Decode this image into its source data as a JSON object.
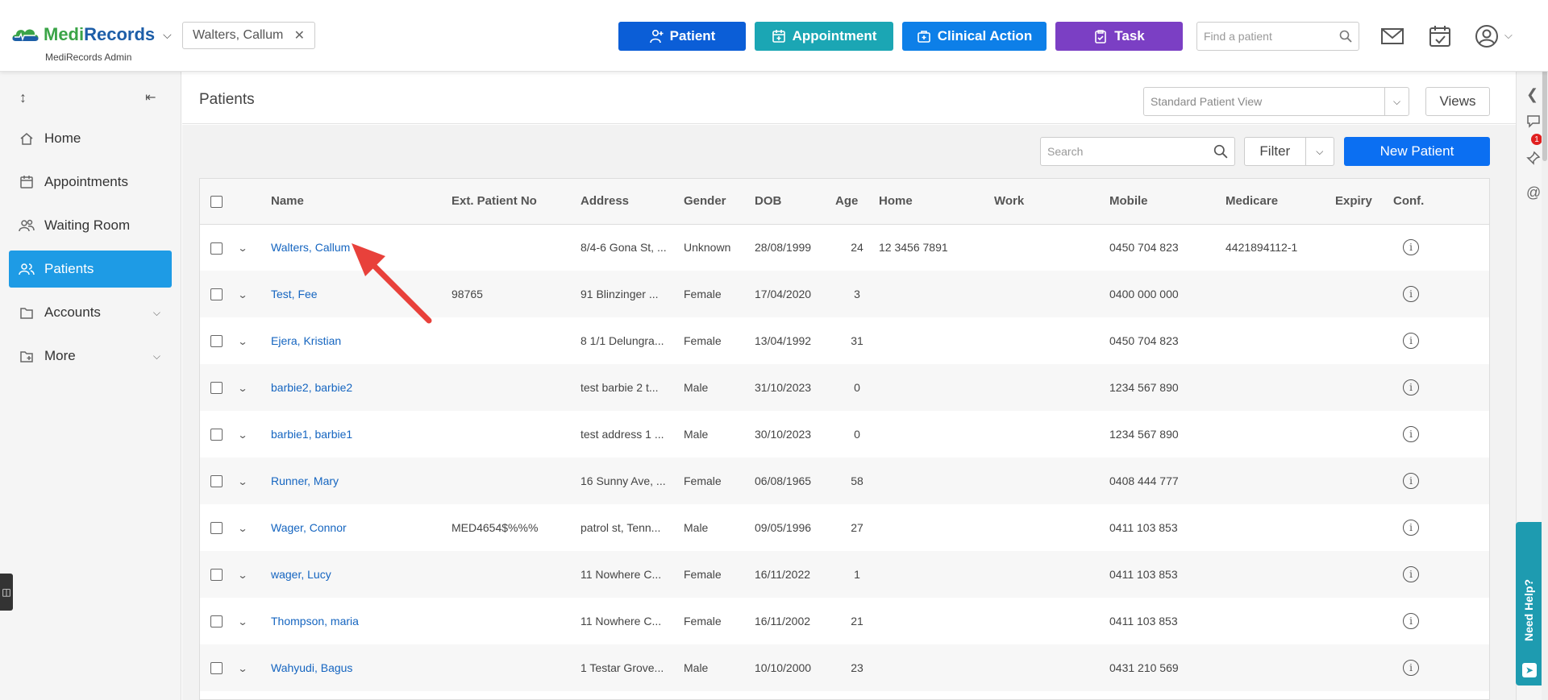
{
  "app": {
    "logo_text": "MediRecords",
    "subtitle": "MediRecords Admin",
    "open_patient": "Walters, Callum"
  },
  "header": {
    "buttons": [
      {
        "label": "Patient",
        "color": "#0b5ed7"
      },
      {
        "label": "Appointment",
        "color": "#1ba6b4"
      },
      {
        "label": "Clinical Action",
        "color": "#0d7fe8"
      },
      {
        "label": "Task",
        "color": "#7b3fc4"
      }
    ],
    "find_placeholder": "Find a patient"
  },
  "sidebar": {
    "items": [
      {
        "label": "Home",
        "icon": "home-icon"
      },
      {
        "label": "Appointments",
        "icon": "calendar-icon"
      },
      {
        "label": "Waiting Room",
        "icon": "group-icon"
      },
      {
        "label": "Patients",
        "icon": "patients-icon",
        "active": true
      },
      {
        "label": "Accounts",
        "icon": "accounts-icon"
      },
      {
        "label": "More",
        "icon": "more-icon"
      }
    ]
  },
  "page": {
    "title": "Patients",
    "view_select": "Standard Patient View",
    "views_label": "Views",
    "search_placeholder": "Search",
    "filter_label": "Filter",
    "new_patient_label": "New Patient"
  },
  "table": {
    "columns": [
      "Name",
      "Ext. Patient No",
      "Address",
      "Gender",
      "DOB",
      "Age",
      "Home",
      "Work",
      "Mobile",
      "Medicare",
      "Expiry",
      "Conf."
    ],
    "rows": [
      [
        "Walters, Callum",
        "",
        "8/4-6 Gona St, ...",
        "Unknown",
        "28/08/1999",
        "24",
        "12 3456 7891",
        "",
        "0450 704 823",
        "4421894112-1",
        ""
      ],
      [
        "Test, Fee",
        "98765",
        "91 Blinzinger ...",
        "Female",
        "17/04/2020",
        "3",
        "",
        "",
        "0400 000 000",
        "",
        ""
      ],
      [
        "Ejera, Kristian",
        "",
        "8 1/1 Delungra...",
        "Female",
        "13/04/1992",
        "31",
        "",
        "",
        "0450 704 823",
        "",
        ""
      ],
      [
        "barbie2, barbie2",
        "",
        "test barbie 2 t...",
        "Male",
        "31/10/2023",
        "0",
        "",
        "",
        "1234 567 890",
        "",
        ""
      ],
      [
        "barbie1, barbie1",
        "",
        "test address 1 ...",
        "Male",
        "30/10/2023",
        "0",
        "",
        "",
        "1234 567 890",
        "",
        ""
      ],
      [
        "Runner, Mary",
        "",
        "16 Sunny Ave, ...",
        "Female",
        "06/08/1965",
        "58",
        "",
        "",
        "0408 444 777",
        "",
        ""
      ],
      [
        "Wager, Connor",
        "MED4654$%%%",
        "patrol st, Tenn...",
        "Male",
        "09/05/1996",
        "27",
        "",
        "",
        "0411 103 853",
        "",
        ""
      ],
      [
        "wager, Lucy",
        "",
        "11 Nowhere C...",
        "Female",
        "16/11/2022",
        "1",
        "",
        "",
        "0411 103 853",
        "",
        ""
      ],
      [
        "Thompson, maria",
        "",
        "11 Nowhere C...",
        "Female",
        "16/11/2002",
        "21",
        "",
        "",
        "0411 103 853",
        "",
        ""
      ],
      [
        "Wahyudi, Bagus",
        "",
        "1 Testar Grove...",
        "Male",
        "10/10/2000",
        "23",
        "",
        "",
        "0431 210 569",
        "",
        ""
      ]
    ]
  },
  "rail": {
    "notification_count": "1",
    "help_label": "Need Help?"
  }
}
